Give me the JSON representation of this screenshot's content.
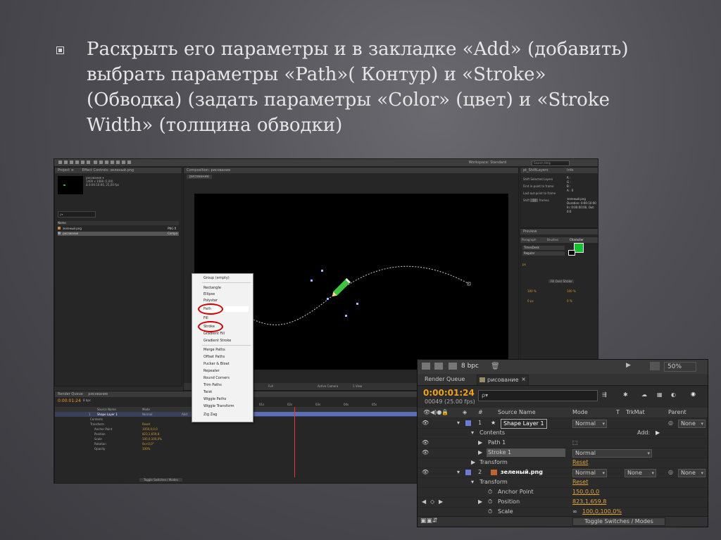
{
  "slide": {
    "line1": "Раскрыть его параметры и в закладке «Add» (добавить)",
    "line2": "выбрать параметры «Path»( Контур) и «Stroke»",
    "line3": "(Обводка) (задать параметры «Color» (цвет) и «Stroke",
    "line4": "Width» (толщина обводки)"
  },
  "main": {
    "workspace_label": "Workspace:  Standard",
    "search_placeholder": "Search Help",
    "project_tab": "Project ≡",
    "effect_controls_tab": "Effect Controls: зеленый.png",
    "composition_tab": "Composition: рисование",
    "comp_subtab": "рисование",
    "project_info_name": "рисование ▾",
    "project_info_dims": "1400 x 1080 (1,00)",
    "project_info_time": "Δ 0:00:10:00, 25,00 fps",
    "project_col_name": "Name",
    "project_items": [
      "зеленый.png",
      "рисование"
    ],
    "project_item_types": [
      "PNG fi",
      "Compo"
    ],
    "right_panel_tab": "pt_ShiftLayers",
    "info_tab": "Info",
    "info_lines": [
      "R :",
      "G :",
      "B :",
      "A : 0"
    ],
    "shift_options": [
      "Shift Selected Layers",
      "First in-point to frame",
      "Last out-point to frame"
    ],
    "shift_label": "Shift",
    "shift_value": "10",
    "shift_unit": "frames",
    "info_file": "зеленый.png",
    "info_duration": "Duration: 0:00:10:00",
    "info_in": "In: 0:00:00:00, Out: 0:0",
    "preview_tab": "Preview",
    "paragraph_tab": "Paragraph",
    "brushes_tab": "Brushes",
    "character_tab": "Character",
    "font_name": "TimesDesk",
    "font_style": "Regular",
    "font_size": "px",
    "stroke_option": "Fill Over Stroke",
    "tracking_values": [
      "100 %",
      "100 %"
    ],
    "baseline_values": [
      "0 px",
      "0 %"
    ],
    "magnification": "50%",
    "resolution": "Full",
    "camera": "Active Camera",
    "view": "1 View",
    "timeline": {
      "render_queue": "Render Queue",
      "comp_tab": "рисование",
      "time": "0:00:01:24",
      "bpc": "8 bpc",
      "col_source": "Source Name",
      "col_mode": "Mode",
      "layer_num": "1",
      "layer_name": "Shape Layer 1",
      "layer_mode": "Normal",
      "add_label": "Add:",
      "contents_label": "Contents",
      "transform_label": "Transform",
      "reset_label": "Reset",
      "props": [
        {
          "name": "Anchor Point",
          "value": "1050,0,0,0"
        },
        {
          "name": "Position",
          "value": "823,1,659,8"
        },
        {
          "name": "Scale",
          "value": "100,0,100,0%"
        },
        {
          "name": "Rotation",
          "value": "0x+0,0°"
        },
        {
          "name": "Opacity",
          "value": "100%"
        }
      ],
      "toggle": "Toggle Switches / Modes",
      "ruler_marks": [
        "00s",
        "01s",
        "02s",
        "03s",
        "04s",
        "05s"
      ]
    }
  },
  "menu": {
    "items": [
      "Group (empty)",
      "Rectangle",
      "Ellipse",
      "Polystar",
      "Path",
      "Fill",
      "Stroke",
      "Gradient Fill",
      "Gradient Stroke",
      "Merge Paths",
      "Offset Paths",
      "Pucker & Bloat",
      "Repeater",
      "Round Corners",
      "Trim Paths",
      "Twist",
      "Wiggle Paths",
      "Wiggle Transform",
      "Zig Zag"
    ],
    "highlight_color": "#d40000"
  },
  "overlay": {
    "render_queue": "Render Queue",
    "comp_tab": "рисование",
    "time": "0:00:01:24",
    "frame_info": "00049 (25.00 fps)",
    "bpc": "8 bpc",
    "zoom": "50%",
    "search_prefix": "ρ▾",
    "col_num": "#",
    "col_source": "Source Name",
    "col_mode": "Mode",
    "col_t": "T",
    "col_trkmat": "TrkMat",
    "col_parent": "Parent",
    "layer1": {
      "num": "1",
      "name": "Shape Layer 1",
      "mode": "Normal",
      "parent": "None"
    },
    "contents_label": "Contents",
    "add_label": "Add:",
    "path_label": "Path 1",
    "stroke_label": "Stroke 1",
    "stroke_mode": "Normal",
    "transform_label": "Transform",
    "reset_label": "Reset",
    "layer2": {
      "num": "2",
      "name": "зеленый.png",
      "mode": "Normal",
      "trkmat": "None",
      "parent": "None"
    },
    "transform2_label": "Transform",
    "reset2_label": "Reset",
    "anchor_label": "Anchor Point",
    "anchor_value": "150,0,0,0",
    "position_label": "Position",
    "position_value": "823,1,659,8",
    "scale_label": "Scale",
    "scale_value": "100,0,100,0%",
    "toggle": "Toggle Switches / Modes",
    "accent_time": "#f0a020",
    "label_blue": "#6b7ad8"
  }
}
